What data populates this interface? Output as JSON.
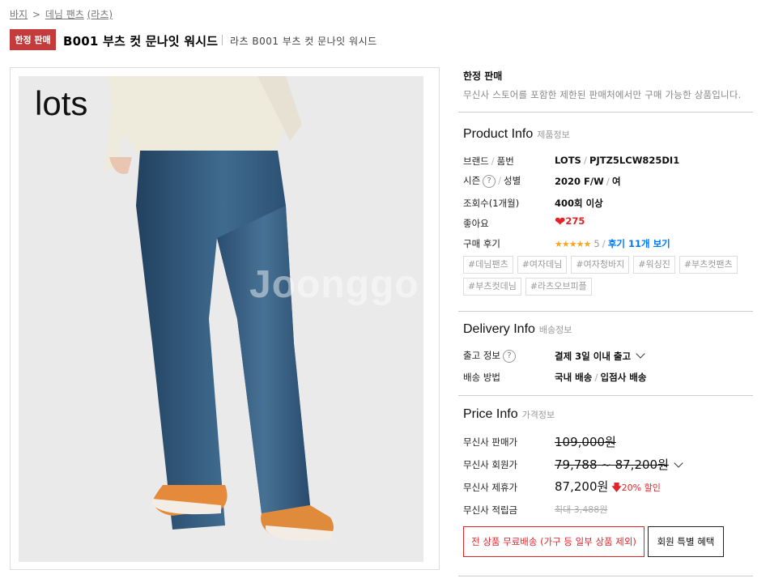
{
  "breadcrumb": {
    "items": [
      "바지",
      "데님 팬츠",
      "(라츠)"
    ],
    "separator": ">"
  },
  "header": {
    "badge": "한정 판매",
    "title": "B001 부츠 컷 문나잇 워시드",
    "subtitle": "라츠 B001 부츠 컷 문나잇 워시드"
  },
  "image": {
    "brand_text": "lots",
    "watermark": "Joonggo"
  },
  "limited": {
    "title": "한정 판매",
    "desc": "무신사 스토어를 포함한 제한된 판매처에서만 구매 가능한 상품입니다."
  },
  "product_info": {
    "title": "Product Info",
    "title_ko": "제품정보",
    "brand_label": "브랜드",
    "code_label": "품번",
    "brand": "LOTS",
    "code": "PJTZ5LCW825DI1",
    "season_label": "시즌",
    "gender_label": "성별",
    "season": "2020 F/W",
    "gender": "여",
    "views_label": "조회수(1개월)",
    "views": "400회 이상",
    "likes_label": "좋아요",
    "likes": "275",
    "review_label": "구매 후기",
    "stars": "★★★★★",
    "score": "5",
    "review_link": "후기 11개 보기",
    "tags": [
      "#데님팬츠",
      "#여자데님",
      "#여자청바지",
      "#워싱진",
      "#부츠컷팬츠",
      "#부츠컷데님",
      "#라츠오브피플"
    ]
  },
  "delivery_info": {
    "title": "Delivery Info",
    "title_ko": "배송정보",
    "ship_label": "출고 정보",
    "ship_value": "결제 3일 이내 출고",
    "method_label": "배송 방법",
    "method_1": "국내 배송",
    "method_2": "입점사 배송"
  },
  "price_info": {
    "title": "Price Info",
    "title_ko": "가격정보",
    "sale_label": "무신사 판매가",
    "sale_price": "109,000원",
    "member_label": "무신사 회원가",
    "member_price": "79,788 ~ 87,200원",
    "partner_label": "무신사 제휴가",
    "partner_price": "87,200원",
    "discount": "20% 할인",
    "points_label": "무신사 적립금",
    "points": "최대 3,488원"
  },
  "buttons": {
    "free_shipping": "전 상품 무료배송 (가구 등 일부 상품 제외)",
    "member_benefit": "회원 특별 혜택"
  },
  "colors": {
    "accent_red": "#e0242a",
    "badge_red": "#c43b3b",
    "star": "#f5a623",
    "link_blue": "#0078ff"
  },
  "icons": [
    "question-icon",
    "heart-icon",
    "chevron-down-icon",
    "arrow-down-icon"
  ]
}
